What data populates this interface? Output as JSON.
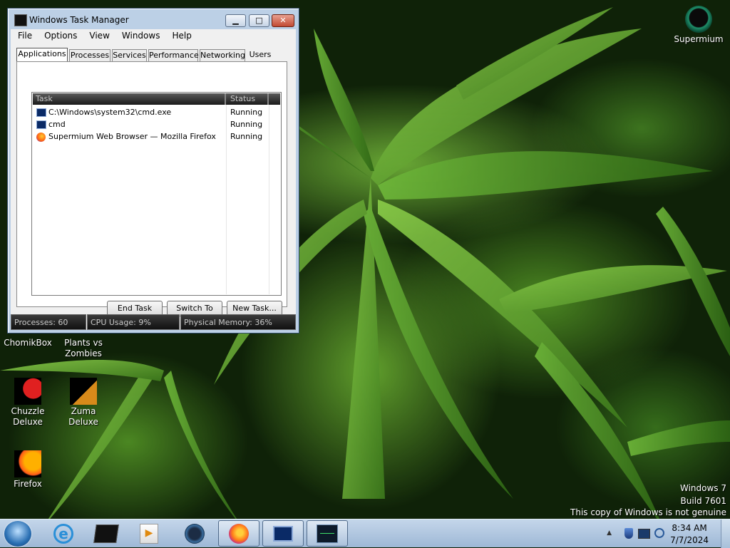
{
  "window": {
    "title": "Windows Task Manager",
    "minimize_label": "▁",
    "maximize_label": "□",
    "close_label": "✕"
  },
  "menu": [
    "File",
    "Options",
    "View",
    "Windows",
    "Help"
  ],
  "tabs": [
    {
      "label": "Applications",
      "active": true
    },
    {
      "label": "Processes",
      "active": false
    },
    {
      "label": "Services",
      "active": false
    },
    {
      "label": "Performance",
      "active": false
    },
    {
      "label": "Networking",
      "active": false
    },
    {
      "label": "Users",
      "active": false
    }
  ],
  "task_list": {
    "columns": [
      "Task",
      "Status"
    ],
    "rows": [
      {
        "icon": "cmd-icon",
        "task": "C:\\Windows\\system32\\cmd.exe",
        "status": "Running"
      },
      {
        "icon": "cmd-icon",
        "task": "cmd",
        "status": "Running"
      },
      {
        "icon": "firefox-icon",
        "task": "Supermium Web Browser — Mozilla Firefox",
        "status": "Running"
      }
    ]
  },
  "buttons": {
    "end_task": "End Task",
    "switch_to": "Switch To",
    "new_task": "New Task..."
  },
  "status_bar": {
    "processes": "Processes: 60",
    "cpu": "CPU Usage: 9%",
    "memory": "Physical Memory: 36%"
  },
  "desktop_icons": [
    {
      "label": "Supermium",
      "icon": "supermium-icon"
    },
    {
      "label": "ChomikBox",
      "icon": "chomikbox-icon"
    },
    {
      "label": "Plants vs Zombies",
      "icon": "pvz-icon"
    },
    {
      "label": "Chuzzle Deluxe",
      "icon": "chuzzle-icon"
    },
    {
      "label": "Zuma Deluxe",
      "icon": "zuma-icon"
    },
    {
      "label": "Firefox",
      "icon": "firefox-icon"
    }
  ],
  "watermark": {
    "line1": "Windows 7",
    "line2": "Build 7601",
    "line3": "This copy of Windows is not genuine"
  },
  "clock": {
    "time": "8:34 AM",
    "date": "7/7/2024"
  },
  "taskbar_items": [
    "ie-icon",
    "terminal-icon",
    "media-player-icon",
    "supermium-icon",
    "firefox-icon",
    "cmd-icon",
    "task-manager-icon"
  ],
  "colors": {
    "titlebar": "#bcd0e6",
    "taskbar": "#b4cae2",
    "close": "#c24a33"
  }
}
